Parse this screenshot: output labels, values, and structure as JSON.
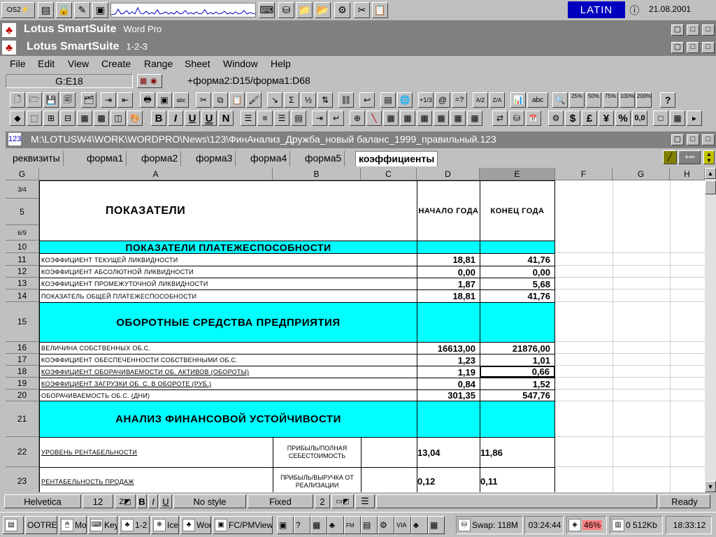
{
  "desktop": {
    "keyboard_layout": "LATIN",
    "date": "21.08.2001"
  },
  "app_window": {
    "title": "Lotus SmartSuite",
    "subtitle": "Word Pro"
  },
  "sheet_window": {
    "title": "Lotus SmartSuite",
    "subtitle": "1-2-3"
  },
  "menu": [
    "File",
    "Edit",
    "View",
    "Create",
    "Range",
    "Sheet",
    "Window",
    "Help"
  ],
  "formula_bar": {
    "cell_ref": "G:E18",
    "formula": "+форма2:D15/форма1:D68"
  },
  "toolbar_text": {
    "abc1": "abc",
    "frac": "+1/3",
    "eq": "=?",
    "az": "A/Z",
    "za": "Z/A",
    "abc2": "abc",
    "z25": "25%",
    "z50": "50%",
    "z75": "75%",
    "z100": "100%",
    "z200": "200%",
    "help": "?",
    "bold": "B",
    "italic": "I",
    "underline": "U",
    "dbl_underline": "U",
    "normal": "N",
    "dollar": "$",
    "pound": "£",
    "yen": "¥",
    "percent": "%",
    "decimal": "0,0"
  },
  "document_path": "M:\\LOTUSW4\\WORK\\WORDPRO\\News\\123\\ФинАнализ_Дружба_новый баланс_1999_правильный.123",
  "tabs": [
    "реквизиты",
    "форма1",
    "форма2",
    "форма3",
    "форма4",
    "форма5",
    "коэффициенты"
  ],
  "grid": {
    "corner": "G",
    "columns": [
      "A",
      "B",
      "C",
      "D",
      "E",
      "F",
      "G",
      "H"
    ],
    "rows": {
      "r34": "3/4",
      "r5": "5",
      "r69": "6/9",
      "r10": "10",
      "r11": "11",
      "r12": "12",
      "r13": "13",
      "r14": "14",
      "r15": "15",
      "r16": "16",
      "r17": "17",
      "r18": "18",
      "r19": "19",
      "r20": "20",
      "r21": "21",
      "r22": "22",
      "r23": "23"
    },
    "header_indicators": "ПОКАЗАТЕЛИ",
    "header_start": "НАЧАЛО ГОДА",
    "header_end": "КОНЕЦ ГОДА",
    "section1": "ПОКАЗАТЕЛИ ПЛАТЕЖЕСПОСОБНОСТИ",
    "section2": "ОБОРОТНЫЕ СРЕДСТВА ПРЕДПРИЯТИЯ",
    "section3": "АНАЛИЗ ФИНАНСОВОЙ  УСТОЙЧИВОСТИ",
    "r11": {
      "label": "КОЭФФИЦИЕНТ ТЕКУЩЕЙ ЛИКВИДНОСТИ",
      "start": "18,81",
      "end": "41,76"
    },
    "r12": {
      "label": "КОЭФФИЦИЕНТ АБСОЛЮТНОЙ ЛИКВИДНОСТИ",
      "start": "0,00",
      "end": "0,00"
    },
    "r13": {
      "label": "КОЭФФИЦИЕНТ ПРОМЕЖУТОЧНОЙ  ЛИКВИДНОСТИ",
      "start": "1,87",
      "end": "5,68"
    },
    "r14": {
      "label": "ПОКАЗАТЕЛЬ ОБЩЕЙ ПЛАТЕЖЕСПОСОБНОСТИ",
      "start": "18,81",
      "end": "41,76"
    },
    "r16": {
      "label": "ВЕЛИЧИНА СОБСТВЕННЫХ ОБ.С.",
      "start": "16613,00",
      "end": "21876,00"
    },
    "r17": {
      "label": "КОЭФФИЦИЕНТ  ОБЕСПЕЧЕННОСТИ СОБСТВЕННЫМИ ОБ.С.",
      "start": "1,23",
      "end": "1,01"
    },
    "r18": {
      "label": "КОЭФФИЦИЕНТ ОБОРАЧИВАЕМОСТИ ОБ. АКТИВОВ (ОБОРОТЫ)",
      "start": "1,19",
      "end": "0,66"
    },
    "r19": {
      "label": "КОЭФФИЦИЕНТ ЗАГРУЗКИ ОБ. С. В ОБОРОТЕ (РУБ.)",
      "start": "0,84",
      "end": "1,52"
    },
    "r20": {
      "label": "ОБОРАЧИВАЕМОСТЬ ОБ.С. (ДНИ)",
      "start": "301,35",
      "end": "547,76"
    },
    "r22": {
      "label": "УРОВЕНЬ РЕНТАБЕЛЬНОСТИ",
      "formula": "ПРИБЫЛЬ/ПОЛНАЯ СЕБЕСТОИМОСТЬ",
      "start": "13,04",
      "end": "11,86"
    },
    "r23": {
      "label": "РЕНТАБЕЛЬНОСТЬ ПРОДАЖ",
      "formula": "ПРИБЫЛЬ/ВЫРУЧКА ОТ РЕАЛИЗАЦИИ",
      "start": "0,12",
      "end": "0,11"
    }
  },
  "status_bar": {
    "font": "Helvetica",
    "size": "12",
    "bold": "B",
    "italic": "I",
    "underline": "U",
    "style": "No style",
    "format": "Fixed",
    "decimals": "2",
    "mode": "Ready"
  },
  "taskbar": {
    "tasks": [
      "OOTRE",
      "Mou",
      "Key",
      "1-2",
      "Ice",
      "Wor",
      "FC/PMView"
    ],
    "swap": "Swap: 118M",
    "uptime": "03:24:44",
    "cpu": "46%",
    "mem": "0 512Kb",
    "clock": "18:33:12"
  }
}
